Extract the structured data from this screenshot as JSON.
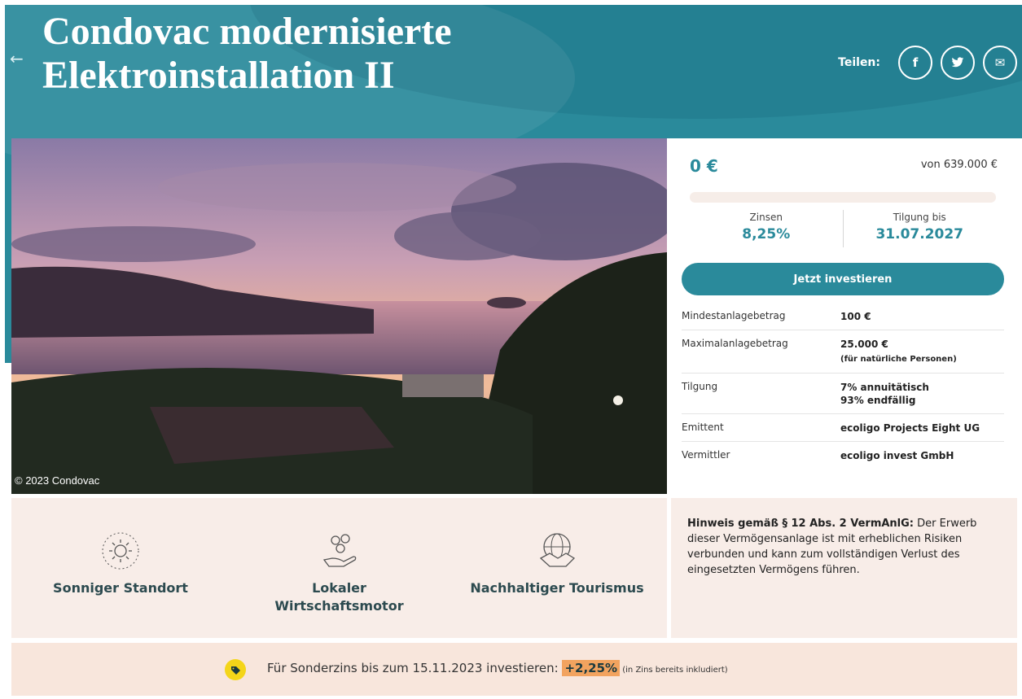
{
  "header": {
    "title": "Condovac modernisierte Elektroinstallation II",
    "back_icon": "arrow-left-icon",
    "share_label": "Teilen:",
    "share_buttons": [
      "f",
      "t",
      "✉"
    ]
  },
  "photo": {
    "copyright": "© 2023 Condovac"
  },
  "funding": {
    "current": "0 €",
    "target": "von 639.000 €",
    "progress_percent": 0,
    "interest_label": "Zinsen",
    "interest_value": "8,25%",
    "repayment_label": "Tilgung bis",
    "repayment_value": "31.07.2027",
    "invest_button": "Jetzt investieren"
  },
  "details": [
    {
      "key": "Mindestanlagebetrag",
      "value": "100 €",
      "note": ""
    },
    {
      "key": "Maximalanlagebetrag",
      "value": "25.000 €",
      "note": "(für natürliche Personen)"
    },
    {
      "key": "Tilgung",
      "value": "7% annuitätisch",
      "note2": "93% endfällig"
    },
    {
      "key": "Emittent",
      "value": "ecoligo Projects Eight UG"
    },
    {
      "key": "Vermittler",
      "value": "ecoligo invest GmbH"
    }
  ],
  "features": [
    {
      "label": "Sonniger Standort",
      "icon": "sun-icon"
    },
    {
      "label_line1": "Lokaler",
      "label_line2": "Wirtschaftsmotor",
      "icon": "coins-hand-icon"
    },
    {
      "label": "Nachhaltiger Tourismus",
      "icon": "globe-handshake-icon"
    }
  ],
  "notice": {
    "bold": "Hinweis gemäß § 12 Abs. 2 VermAnlG:",
    "text": " Der Erwerb dieser Vermögensanlage ist mit erheblichen Risiken verbunden und kann zum vollständigen Verlust des eingesetzten Vermögens führen."
  },
  "banner": {
    "text": "Für Sonderzins bis zum 15.11.2023 investieren: ",
    "bonus": "+2,25%",
    "note": " (in Zins bereits inkludiert)"
  },
  "colors": {
    "brand": "#2a8a9b",
    "feature_bg": "#f8ede8",
    "banner_bg": "#f8e6dc",
    "bonus": "#f2a35f",
    "tag": "#f4d519"
  }
}
